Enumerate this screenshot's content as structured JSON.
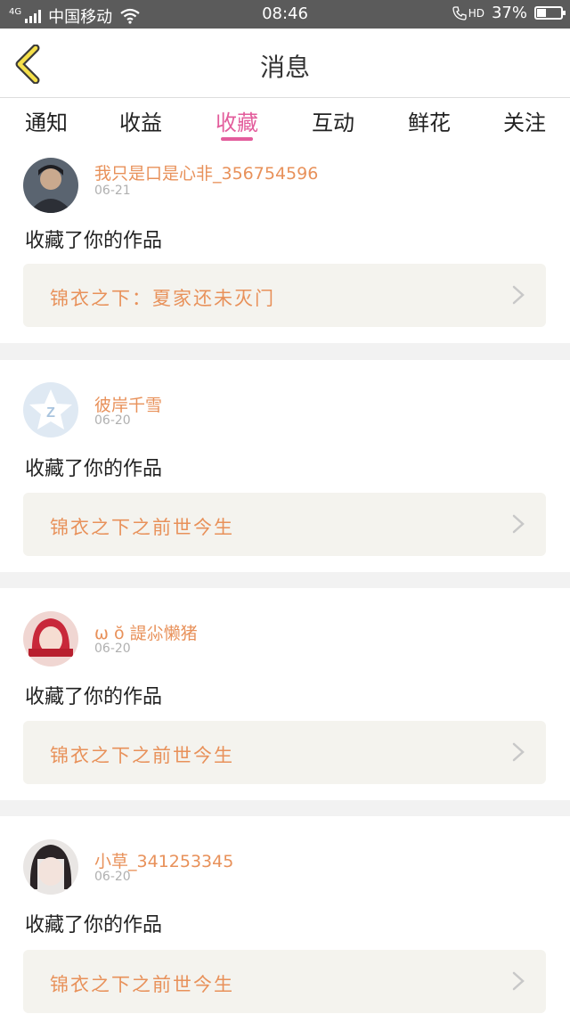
{
  "status_bar": {
    "network": "4G",
    "carrier": "中国移动",
    "time": "08:46",
    "hd": "HD",
    "battery_percent": "37%",
    "battery_level": 0.37,
    "icons": [
      "signal-icon",
      "wifi-icon",
      "phone-hd-icon",
      "battery-icon"
    ]
  },
  "header": {
    "title": "消息",
    "back_icon": "chevron-left-icon"
  },
  "tabs": [
    {
      "label": "通知"
    },
    {
      "label": "收益"
    },
    {
      "label": "收藏",
      "active": true
    },
    {
      "label": "互动"
    },
    {
      "label": "鲜花"
    },
    {
      "label": "关注"
    }
  ],
  "accent_color": "#e35d9c",
  "name_color": "#e8915a",
  "messages": [
    {
      "username": "我只是口是心非_356754596",
      "date": "06-21",
      "action": "收藏了你的作品",
      "work": "锦衣之下：夏家还未灭门"
    },
    {
      "username": "彼岸千雪",
      "date": "06-20",
      "action": "收藏了你的作品",
      "work": "锦衣之下之前世今生"
    },
    {
      "username": "ω ŏ 諟尛懒猪",
      "date": "06-20",
      "action": "收藏了你的作品",
      "work": "锦衣之下之前世今生"
    },
    {
      "username": "小草_341253345",
      "date": "06-20",
      "action": "收藏了你的作品",
      "work": "锦衣之下之前世今生"
    }
  ]
}
